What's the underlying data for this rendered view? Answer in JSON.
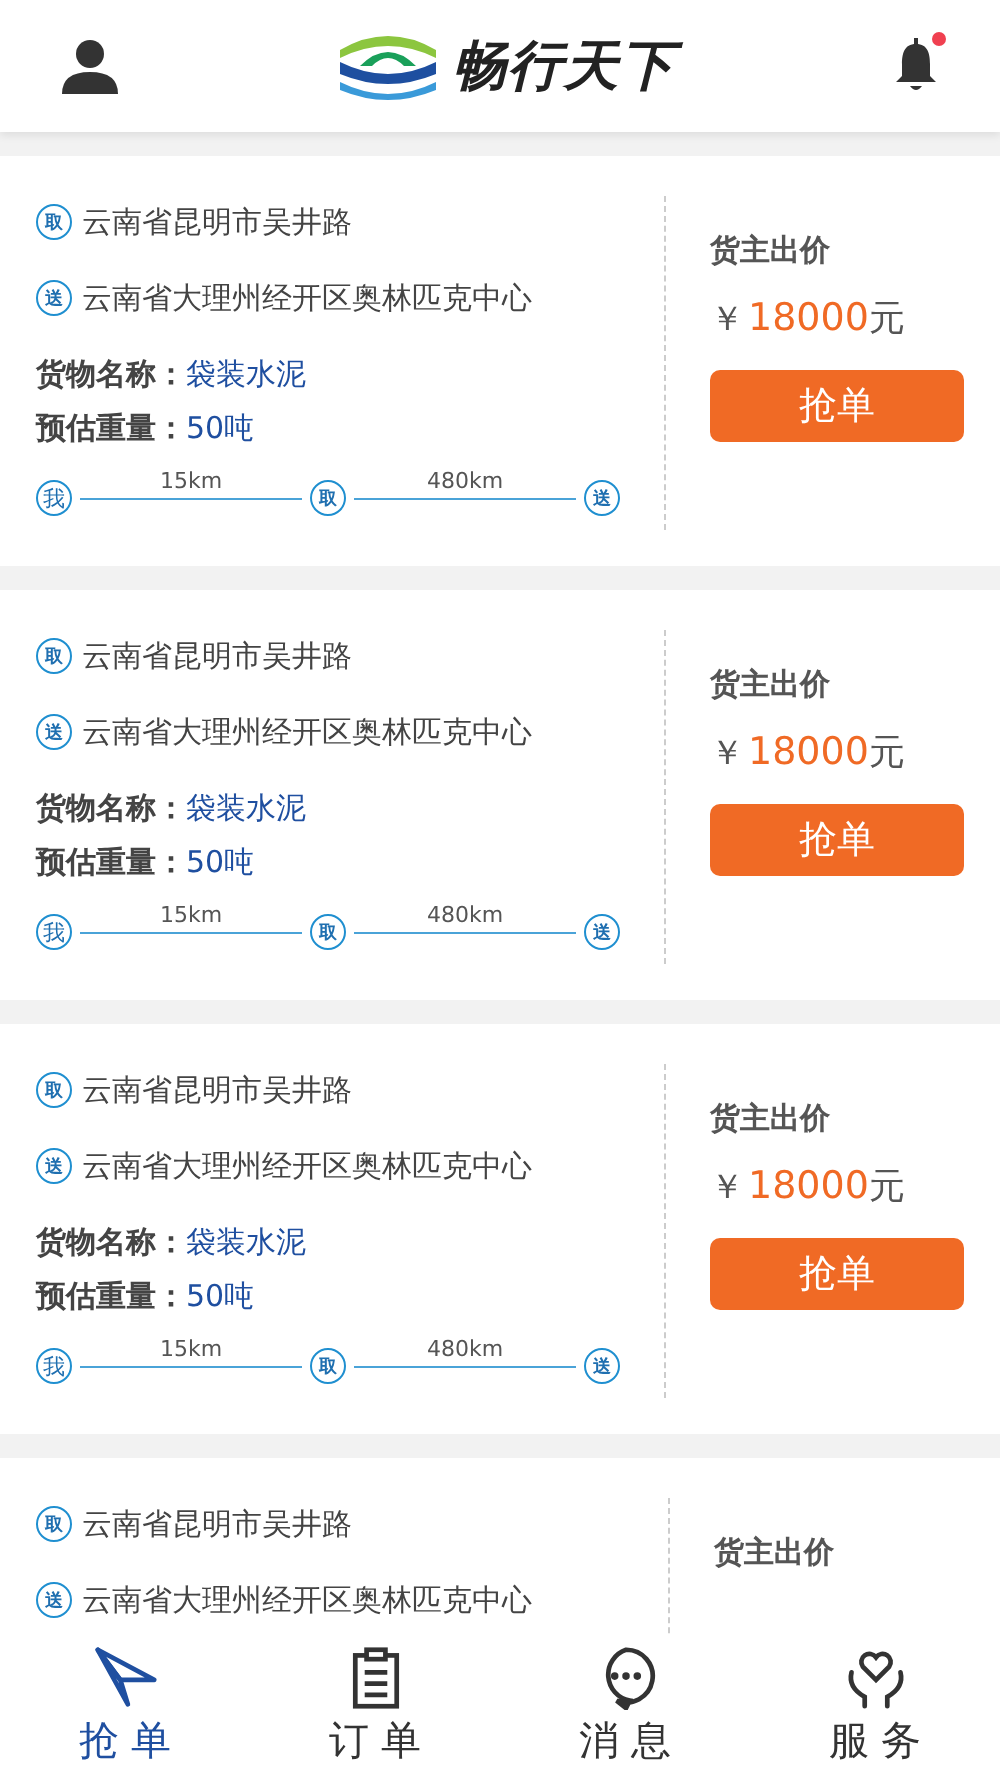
{
  "header": {
    "logo_text": "畅行天下",
    "notification_unread": true
  },
  "orders": [
    {
      "pickup": {
        "mark": "取",
        "address": "云南省昆明市吴井路"
      },
      "delivery": {
        "mark": "送",
        "address": "云南省大理州经开区奥林匹克中心"
      },
      "cargo": {
        "label": "货物名称：",
        "value": "袋装水泥"
      },
      "weight": {
        "label": "预估重量：",
        "value": "50吨"
      },
      "route": {
        "start": "我",
        "leg_1": "15km",
        "middle": "取",
        "leg_2": "480km",
        "end": "送"
      },
      "price_label": "货主出价",
      "price": {
        "currency": "￥",
        "amount": "18000",
        "unit": "元"
      },
      "button": "抢单"
    },
    {
      "pickup": {
        "mark": "取",
        "address": "云南省昆明市吴井路"
      },
      "delivery": {
        "mark": "送",
        "address": "云南省大理州经开区奥林匹克中心"
      },
      "cargo": {
        "label": "货物名称：",
        "value": "袋装水泥"
      },
      "weight": {
        "label": "预估重量：",
        "value": "50吨"
      },
      "route": {
        "start": "我",
        "leg_1": "15km",
        "middle": "取",
        "leg_2": "480km",
        "end": "送"
      },
      "price_label": "货主出价",
      "price": {
        "currency": "￥",
        "amount": "18000",
        "unit": "元"
      },
      "button": "抢单"
    },
    {
      "pickup": {
        "mark": "取",
        "address": "云南省昆明市吴井路"
      },
      "delivery": {
        "mark": "送",
        "address": "云南省大理州经开区奥林匹克中心"
      },
      "cargo": {
        "label": "货物名称：",
        "value": "袋装水泥"
      },
      "weight": {
        "label": "预估重量：",
        "value": "50吨"
      },
      "route": {
        "start": "我",
        "leg_1": "15km",
        "middle": "取",
        "leg_2": "480km",
        "end": "送"
      },
      "price_label": "货主出价",
      "price": {
        "currency": "￥",
        "amount": "18000",
        "unit": "元"
      },
      "button": "抢单"
    },
    {
      "pickup": {
        "mark": "取",
        "address": "云南省昆明市吴井路"
      },
      "delivery": {
        "mark": "送",
        "address": "云南省大理州经开区奥林匹克中心"
      },
      "price_label": "货主出价"
    }
  ],
  "tabs": [
    {
      "label": "抢单",
      "selected": true
    },
    {
      "label": "订单",
      "selected": false
    },
    {
      "label": "消息",
      "selected": false
    },
    {
      "label": "服务",
      "selected": false
    }
  ]
}
